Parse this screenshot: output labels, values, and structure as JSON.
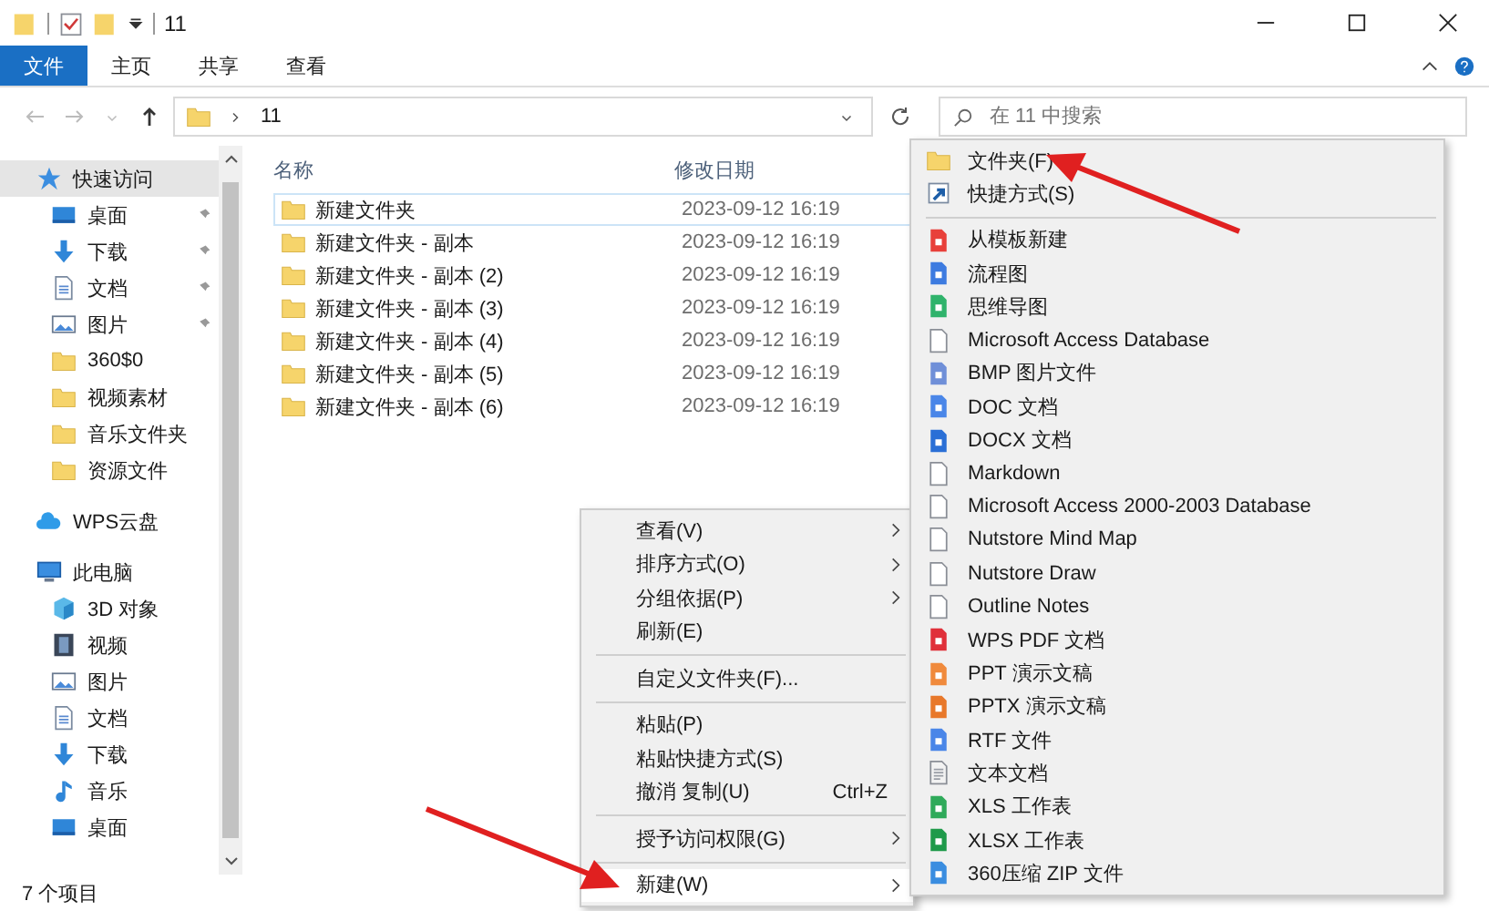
{
  "window": {
    "title": "11"
  },
  "tabs": [
    {
      "label": "文件",
      "selected": true
    },
    {
      "label": "主页",
      "selected": false
    },
    {
      "label": "共享",
      "selected": false
    },
    {
      "label": "查看",
      "selected": false
    }
  ],
  "address": {
    "path": "11",
    "search_placeholder": "在 11 中搜索"
  },
  "sidebar": {
    "items": [
      {
        "label": "快速访问",
        "kind": "star",
        "selected": true,
        "children": [
          {
            "label": "桌面",
            "kind": "desktop",
            "pinned": true
          },
          {
            "label": "下载",
            "kind": "download",
            "pinned": true
          },
          {
            "label": "文档",
            "kind": "document",
            "pinned": true
          },
          {
            "label": "图片",
            "kind": "picture",
            "pinned": true
          },
          {
            "label": "360$0",
            "kind": "folder",
            "pinned": false
          },
          {
            "label": "视频素材",
            "kind": "folder",
            "pinned": false
          },
          {
            "label": "音乐文件夹",
            "kind": "folder",
            "pinned": false
          },
          {
            "label": "资源文件",
            "kind": "folder",
            "pinned": false
          }
        ]
      },
      {
        "label": "WPS云盘",
        "kind": "cloud",
        "selected": false
      },
      {
        "label": "此电脑",
        "kind": "computer",
        "selected": false,
        "children": [
          {
            "label": "3D 对象",
            "kind": "cube",
            "pinned": false
          },
          {
            "label": "视频",
            "kind": "video",
            "pinned": false
          },
          {
            "label": "图片",
            "kind": "picture",
            "pinned": false
          },
          {
            "label": "文档",
            "kind": "document",
            "pinned": false
          },
          {
            "label": "下载",
            "kind": "download",
            "pinned": false
          },
          {
            "label": "音乐",
            "kind": "music",
            "pinned": false
          },
          {
            "label": "桌面",
            "kind": "desktop",
            "pinned": false
          }
        ]
      }
    ]
  },
  "table": {
    "columns": [
      "名称",
      "修改日期"
    ],
    "rows": [
      {
        "name": "新建文件夹",
        "date": "2023-09-12 16:19",
        "selected": true
      },
      {
        "name": "新建文件夹 - 副本",
        "date": "2023-09-12 16:19",
        "selected": false
      },
      {
        "name": "新建文件夹 - 副本 (2)",
        "date": "2023-09-12 16:19",
        "selected": false
      },
      {
        "name": "新建文件夹 - 副本 (3)",
        "date": "2023-09-12 16:19",
        "selected": false
      },
      {
        "name": "新建文件夹 - 副本 (4)",
        "date": "2023-09-12 16:19",
        "selected": false
      },
      {
        "name": "新建文件夹 - 副本 (5)",
        "date": "2023-09-12 16:19",
        "selected": false
      },
      {
        "name": "新建文件夹 - 副本 (6)",
        "date": "2023-09-12 16:19",
        "selected": false
      }
    ]
  },
  "status_bar": {
    "text": "7 个项目"
  },
  "context_menu": {
    "items": [
      {
        "kind": "item",
        "label": "查看(V)",
        "submenu": true,
        "selected": false
      },
      {
        "kind": "item",
        "label": "排序方式(O)",
        "submenu": true,
        "selected": false
      },
      {
        "kind": "item",
        "label": "分组依据(P)",
        "submenu": true,
        "selected": false
      },
      {
        "kind": "item",
        "label": "刷新(E)",
        "submenu": false,
        "selected": false
      },
      {
        "kind": "separator"
      },
      {
        "kind": "item",
        "label": "自定义文件夹(F)...",
        "submenu": false,
        "selected": false
      },
      {
        "kind": "separator"
      },
      {
        "kind": "item",
        "label": "粘贴(P)",
        "submenu": false,
        "selected": false
      },
      {
        "kind": "item",
        "label": "粘贴快捷方式(S)",
        "submenu": false,
        "selected": false
      },
      {
        "kind": "item",
        "label": "撤消 复制(U)",
        "submenu": false,
        "selected": false,
        "shortcut": "Ctrl+Z"
      },
      {
        "kind": "separator"
      },
      {
        "kind": "item",
        "label": "授予访问权限(G)",
        "submenu": true,
        "selected": false
      },
      {
        "kind": "separator"
      },
      {
        "kind": "item",
        "label": "新建(W)",
        "submenu": true,
        "selected": true
      }
    ]
  },
  "new_submenu": {
    "items": [
      {
        "kind": "folder",
        "label": "文件夹(F)"
      },
      {
        "kind": "shortcut",
        "label": "快捷方式(S)"
      },
      {
        "kind": "separator"
      },
      {
        "kind": "doc",
        "label": "从模板新建",
        "color": "#e8403a"
      },
      {
        "kind": "doc",
        "label": "流程图",
        "color": "#3d7be0"
      },
      {
        "kind": "doc",
        "label": "思维导图",
        "color": "#2fb36b"
      },
      {
        "kind": "blank",
        "label": "Microsoft Access Database"
      },
      {
        "kind": "doc",
        "label": "BMP 图片文件",
        "color": "#6f8fd8"
      },
      {
        "kind": "doc",
        "label": "DOC 文档",
        "color": "#4a86e8"
      },
      {
        "kind": "doc",
        "label": "DOCX 文档",
        "color": "#2a6fd6"
      },
      {
        "kind": "blank",
        "label": "Markdown"
      },
      {
        "kind": "blank",
        "label": "Microsoft Access 2000-2003 Database"
      },
      {
        "kind": "blank",
        "label": "Nutstore Mind Map"
      },
      {
        "kind": "blank",
        "label": "Nutstore Draw"
      },
      {
        "kind": "blank",
        "label": "Outline Notes"
      },
      {
        "kind": "doc",
        "label": "WPS PDF 文档",
        "color": "#e0303a"
      },
      {
        "kind": "doc",
        "label": "PPT 演示文稿",
        "color": "#f08a3c"
      },
      {
        "kind": "doc",
        "label": "PPTX 演示文稿",
        "color": "#e8782a"
      },
      {
        "kind": "doc",
        "label": "RTF 文件",
        "color": "#4a86e8"
      },
      {
        "kind": "text",
        "label": "文本文档"
      },
      {
        "kind": "doc",
        "label": "XLS 工作表",
        "color": "#2faa5a"
      },
      {
        "kind": "doc",
        "label": "XLSX 工作表",
        "color": "#1f9a4a"
      },
      {
        "kind": "doc",
        "label": "360压缩 ZIP 文件",
        "color": "#3a8de0"
      }
    ]
  }
}
